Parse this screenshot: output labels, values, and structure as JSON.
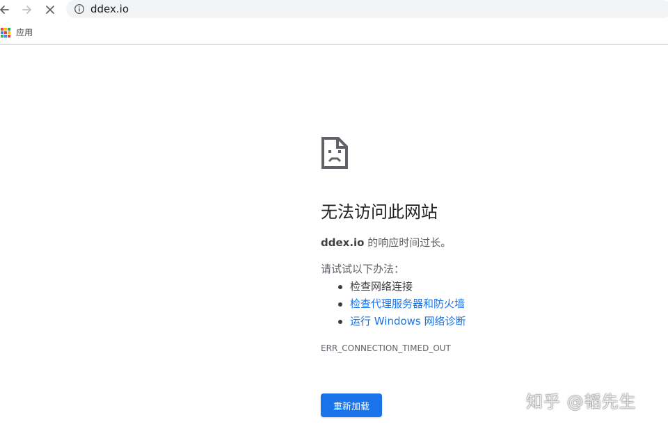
{
  "browser": {
    "url": "ddex.io",
    "bookmarks": {
      "apps_label": "应用",
      "apps_icon_colors": [
        "#ea4335",
        "#fbbc04",
        "#34a853",
        "#4285f4",
        "#ea4335",
        "#fbbc04",
        "#34a853",
        "#4285f4",
        "#ea4335"
      ]
    },
    "icons": {
      "back": "arrow-left-icon",
      "forward": "arrow-right-icon",
      "stop": "close-icon",
      "site_info": "info-circle-icon"
    }
  },
  "error_page": {
    "icon": "sad-page-icon",
    "title": "无法访问此网站",
    "description": {
      "host": "ddex.io",
      "message": " 的响应时间过长。"
    },
    "suggestions_heading": "请试试以下办法：",
    "suggestions": [
      {
        "text": "检查网络连接",
        "link": false
      },
      {
        "text": "检查代理服务器和防火墙",
        "link": true
      },
      {
        "text": "运行 Windows 网络诊断",
        "link": true
      }
    ],
    "error_code": "ERR_CONNECTION_TIMED_OUT",
    "reload_label": "重新加载"
  },
  "watermark": "知乎 @韬先生",
  "colors": {
    "link": "#1a73e8",
    "button": "#1a73e8",
    "text_secondary": "#5f6368"
  }
}
